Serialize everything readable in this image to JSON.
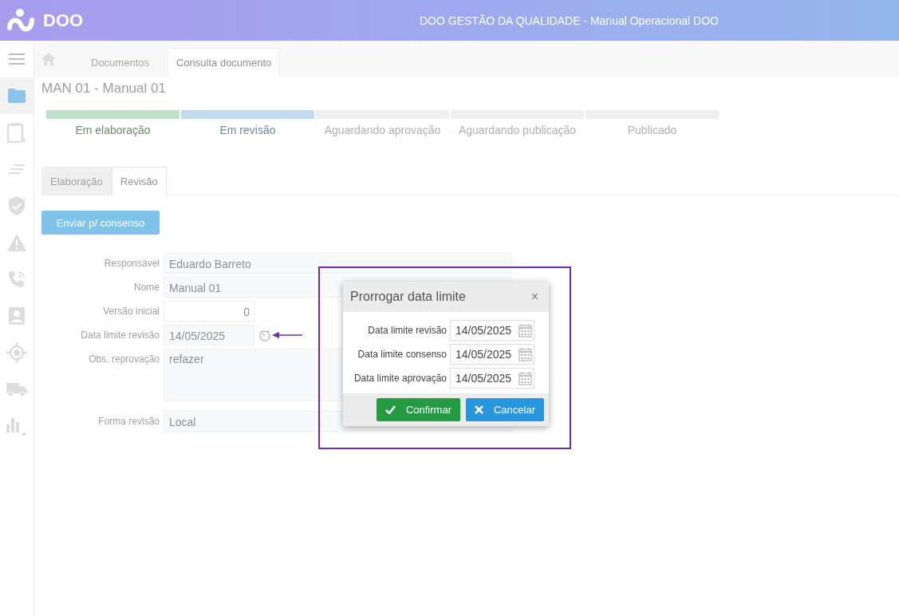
{
  "header": {
    "logo": "DOO",
    "title": "DOO GESTÃO DA QUALIDADE - Manual Operacional DOO"
  },
  "sidebar": {
    "items": [
      {
        "kind": "menu",
        "selected": false
      },
      {
        "kind": "folder",
        "selected": true
      },
      {
        "kind": "clipboard",
        "selected": false
      },
      {
        "kind": "lines",
        "selected": false
      },
      {
        "kind": "shield",
        "selected": false
      },
      {
        "kind": "warning",
        "selected": false
      },
      {
        "kind": "phone",
        "selected": false
      },
      {
        "kind": "contact",
        "selected": false
      },
      {
        "kind": "target",
        "selected": false
      },
      {
        "kind": "truck",
        "selected": false
      },
      {
        "kind": "chart",
        "selected": false
      }
    ]
  },
  "breadcrumb_tabs": [
    {
      "label": "Documentos",
      "selected": false
    },
    {
      "label": "Consulta documento",
      "selected": true
    }
  ],
  "document_title": "MAN 01 - Manual 01",
  "steps": [
    {
      "label": "Em elaboração",
      "color": "#c2e0c9",
      "done": true
    },
    {
      "label": "Em revisão",
      "color": "#c4daf2",
      "done": true
    },
    {
      "label": "Aguardando aprovação",
      "color": "#efefef",
      "done": false
    },
    {
      "label": "Aguardando publicação",
      "color": "#efefef",
      "done": false
    },
    {
      "label": "Publicado",
      "color": "#efefef",
      "done": false
    }
  ],
  "tabs": [
    {
      "label": "Elaboração",
      "selected": false
    },
    {
      "label": "Revisão",
      "selected": true
    }
  ],
  "send_button": "Enviar p/ consenso",
  "form": [
    {
      "label": "Responsável",
      "value": "Eduardo Barreto",
      "kind": "text"
    },
    {
      "label": "Nome",
      "value": "Manual 01",
      "kind": "text"
    },
    {
      "label": "Versão inicial",
      "value": "0",
      "kind": "number"
    },
    {
      "label": "Data limite revisão",
      "value": "14/05/2025",
      "kind": "date"
    },
    {
      "label": "Obs. reprovação",
      "value": "refazer",
      "kind": "textarea"
    },
    {
      "label": "Forma revisão",
      "value": "Local",
      "kind": "text"
    }
  ],
  "dialog": {
    "title": "Prorrogar data limite",
    "close": "×",
    "fields": [
      {
        "label": "Data limite revisão",
        "value": "14/05/2025"
      },
      {
        "label": "Data limite consenso",
        "value": "14/05/2025"
      },
      {
        "label": "Data limite aprovação",
        "value": "14/05/2025"
      }
    ],
    "confirm": "Confirmar",
    "cancel": "Cancelar"
  }
}
